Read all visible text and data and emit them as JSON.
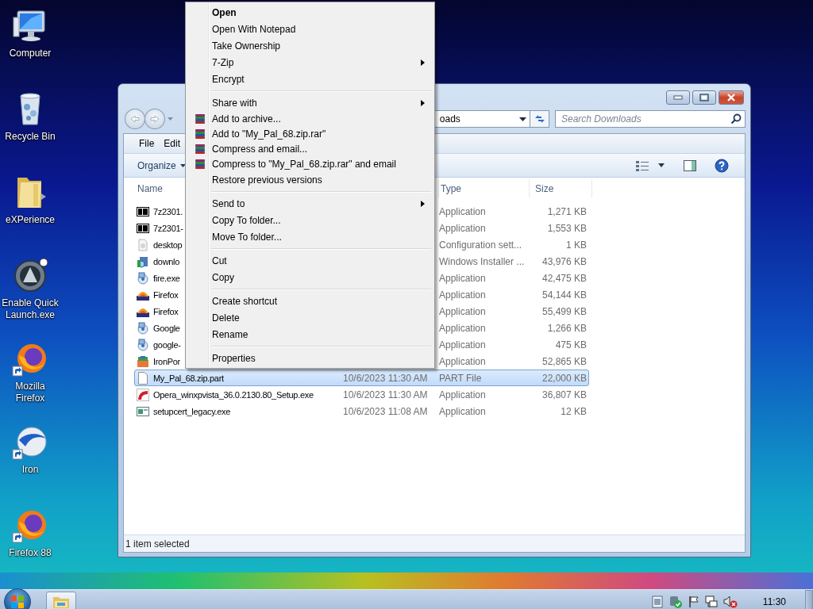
{
  "desktop_icons": [
    {
      "label": "Computer",
      "kind": "computer",
      "shortcut": false
    },
    {
      "label": "Recycle Bin",
      "kind": "trash",
      "shortcut": false
    },
    {
      "label": "eXPerience",
      "kind": "folder",
      "shortcut": false
    },
    {
      "label": "Enable Quick Launch.exe",
      "kind": "launcher",
      "shortcut": false
    },
    {
      "label": "Mozilla Firefox",
      "kind": "firefox",
      "shortcut": true
    },
    {
      "label": "Iron",
      "kind": "iron",
      "shortcut": true
    },
    {
      "label": "Firefox 88",
      "kind": "firefox",
      "shortcut": true
    }
  ],
  "window": {
    "address": "oads",
    "search_placeholder": "Search Downloads",
    "menu_bar": [
      "File",
      "Edit"
    ],
    "organize": "Organize",
    "columns": [
      {
        "label": "Name",
        "kind": "name"
      },
      {
        "label": "Type",
        "kind": "type"
      },
      {
        "label": "Size",
        "kind": "size"
      }
    ],
    "files": [
      {
        "name": "7z2301.",
        "type": "Application",
        "size": "1,271 KB",
        "kind": "sevenzip",
        "selected": false
      },
      {
        "name": "7z2301-",
        "type": "Application",
        "size": "1,553 KB",
        "kind": "sevenzip",
        "selected": false
      },
      {
        "name": "desktop",
        "type": "Configuration sett...",
        "size": "1 KB",
        "kind": "settings",
        "selected": false
      },
      {
        "name": "downlo",
        "type": "Windows Installer ...",
        "size": "43,976 KB",
        "kind": "installer",
        "selected": false
      },
      {
        "name": "fire.exe",
        "type": "Application",
        "size": "42,475 KB",
        "kind": "setup",
        "selected": false
      },
      {
        "name": "Firefox",
        "type": "Application",
        "size": "54,144 KB",
        "kind": "sunset",
        "selected": false
      },
      {
        "name": "Firefox",
        "type": "Application",
        "size": "55,499 KB",
        "kind": "sunset",
        "selected": false
      },
      {
        "name": "Google",
        "type": "Application",
        "size": "1,266 KB",
        "kind": "setup",
        "selected": false
      },
      {
        "name": "google-",
        "type": "Application",
        "size": "475 KB",
        "kind": "setup",
        "selected": false
      },
      {
        "name": "IronPor",
        "type": "Application",
        "size": "52,865 KB",
        "kind": "box",
        "selected": false
      },
      {
        "name": "My_Pal_68.zip.part",
        "date": "10/6/2023 11:30 AM",
        "type": "PART File",
        "size": "22,000 KB",
        "kind": "blank",
        "selected": true
      },
      {
        "name": "Opera_winxpvista_36.0.2130.80_Setup.exe",
        "date": "10/6/2023 11:30 AM",
        "type": "Application",
        "size": "36,807 KB",
        "kind": "arc",
        "selected": false
      },
      {
        "name": "setupcert_legacy.exe",
        "date": "10/6/2023 11:08 AM",
        "type": "Application",
        "size": "12 KB",
        "kind": "window",
        "selected": false
      }
    ],
    "status": "1 item selected"
  },
  "context_menu": {
    "groups": [
      {
        "items": [
          {
            "label": "Open",
            "kind": "plain",
            "default": true,
            "submenu": false
          },
          {
            "label": "Open With Notepad",
            "kind": "plain",
            "default": false,
            "submenu": false
          },
          {
            "label": "Take Ownership",
            "kind": "plain",
            "default": false,
            "submenu": false
          },
          {
            "label": "7-Zip",
            "kind": "plain",
            "default": false,
            "submenu": true
          },
          {
            "label": "Encrypt",
            "kind": "plain",
            "default": false,
            "submenu": false
          }
        ]
      },
      {
        "items": [
          {
            "label": "Share with",
            "kind": "plain",
            "default": false,
            "submenu": true
          },
          {
            "label": "Add to archive...",
            "kind": "archive",
            "default": false,
            "submenu": false
          },
          {
            "label": "Add to \"My_Pal_68.zip.rar\"",
            "kind": "archive",
            "default": false,
            "submenu": false
          },
          {
            "label": "Compress and email...",
            "kind": "archive",
            "default": false,
            "submenu": false
          },
          {
            "label": "Compress to \"My_Pal_68.zip.rar\" and email",
            "kind": "archive",
            "default": false,
            "submenu": false
          },
          {
            "label": "Restore previous versions",
            "kind": "plain",
            "default": false,
            "submenu": false
          }
        ]
      },
      {
        "items": [
          {
            "label": "Send to",
            "kind": "plain",
            "default": false,
            "submenu": true
          },
          {
            "label": "Copy To folder...",
            "kind": "plain",
            "default": false,
            "submenu": false
          },
          {
            "label": "Move To folder...",
            "kind": "plain",
            "default": false,
            "submenu": false
          }
        ]
      },
      {
        "items": [
          {
            "label": "Cut",
            "kind": "plain",
            "default": false,
            "submenu": false
          },
          {
            "label": "Copy",
            "kind": "plain",
            "default": false,
            "submenu": false
          }
        ]
      },
      {
        "items": [
          {
            "label": "Create shortcut",
            "kind": "plain",
            "default": false,
            "submenu": false
          },
          {
            "label": "Delete",
            "kind": "plain",
            "default": false,
            "submenu": false
          },
          {
            "label": "Rename",
            "kind": "plain",
            "default": false,
            "submenu": false
          }
        ]
      },
      {
        "items": [
          {
            "label": "Properties",
            "kind": "plain",
            "default": false,
            "submenu": false
          }
        ]
      }
    ]
  },
  "taskbar": {
    "clock": "11:30"
  }
}
